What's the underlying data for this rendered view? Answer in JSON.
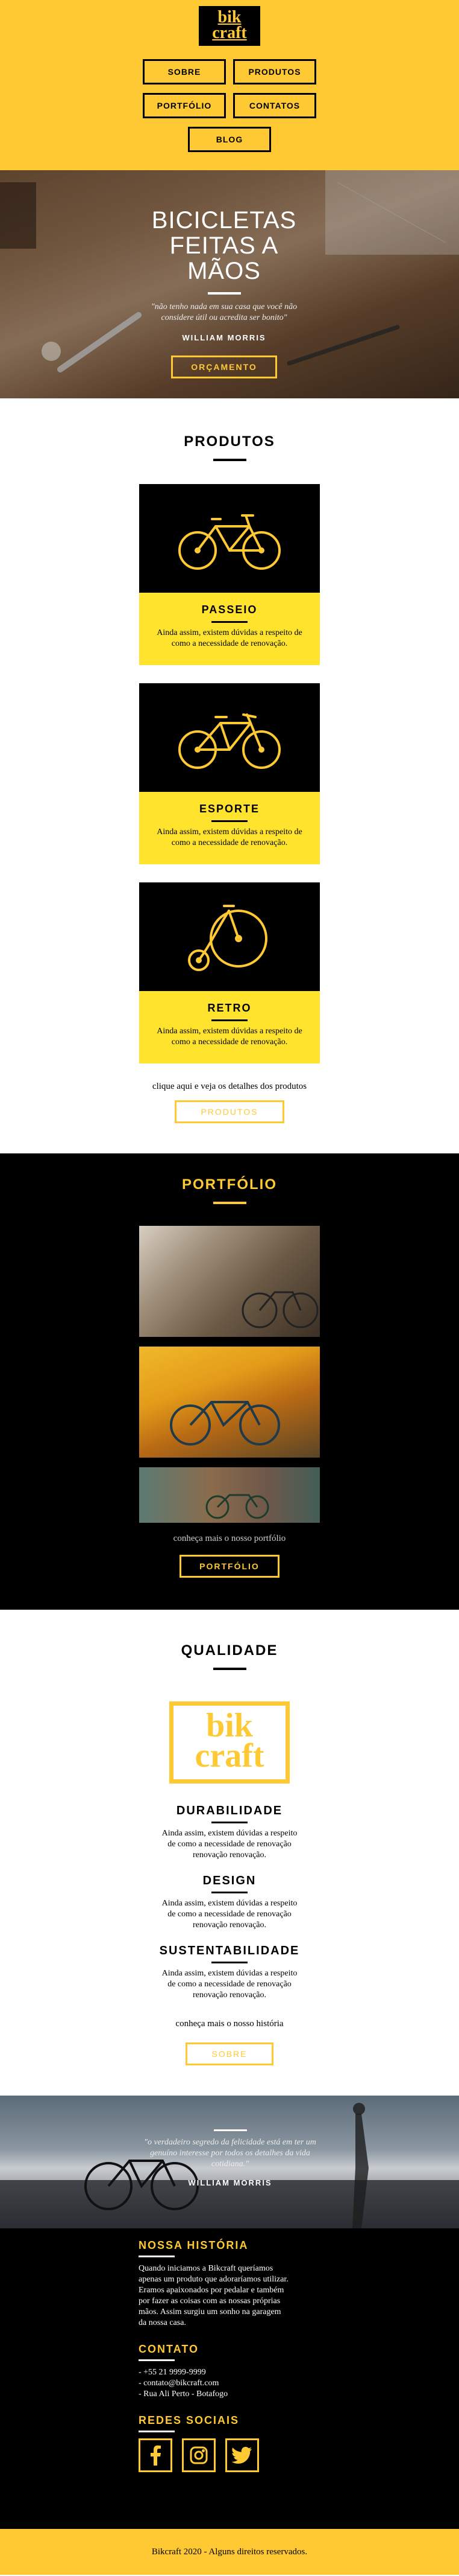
{
  "header": {
    "logo_line1": "bik",
    "logo_line2": "craft",
    "nav": [
      "SOBRE",
      "PRODUTOS",
      "PORTFÓLIO",
      "CONTATOS",
      "BLOG"
    ]
  },
  "hero": {
    "title": "BICICLETAS FEITAS A MÃOS",
    "quote": "\"não tenho nada em sua casa que você não considere útil ou acredita ser bonito\"",
    "author": "WILLIAM MORRIS",
    "button": "ORÇAMENTO"
  },
  "produtos": {
    "title": "PRODUTOS",
    "items": [
      {
        "name": "PASSEIO",
        "text": "Ainda assim, existem dúvidas a respeito de como a necessidade de renovação."
      },
      {
        "name": "ESPORTE",
        "text": "Ainda assim, existem dúvidas a respeito de como a necessidade de renovação."
      },
      {
        "name": "RETRO",
        "text": "Ainda assim, existem dúvidas a respeito de como a necessidade de renovação."
      }
    ],
    "more_text": "clique aqui e veja os detalhes dos produtos",
    "button": "PRODUTOS"
  },
  "portfolio": {
    "title": "PORTFÓLIO",
    "more_text": "conheça mais o nosso portfólio",
    "button": "PORTFÓLIO"
  },
  "qualidade": {
    "title": "QUALIDADE",
    "logo_line1": "bik",
    "logo_line2": "craft",
    "items": [
      {
        "name": "DURABILIDADE",
        "text": "Ainda assim, existem dúvidas a respeito de como a necessidade de renovação renovação renovação."
      },
      {
        "name": "DESIGN",
        "text": "Ainda assim, existem dúvidas a respeito de como a necessidade de renovação renovação renovação."
      },
      {
        "name": "SUSTENTABILIDADE",
        "text": "Ainda assim, existem dúvidas a respeito de como a necessidade de renovação renovação renovação."
      }
    ],
    "more_text": "conheça mais o nosso história",
    "button": "SOBRE"
  },
  "banner": {
    "quote": "\"o verdadeiro segredo da felicidade está em ter um genuíno interesse por todos os detalhes da vida cotidiana.\"",
    "author": "WILLIAM MORRIS"
  },
  "footer": {
    "historia_title": "NOSSA HISTÓRIA",
    "historia_text": "Quando iniciamos a Bikcraft queríamos apenas um produto que adoraríamos utilizar. Eramos apaixonados por pedalar e também por fazer as coisas com as nossas próprias mãos. Assim surgiu um sonho na garagem da nossa casa.",
    "contato_title": "CONTATO",
    "contatos": [
      "- +55 21 9999-9999",
      "- contato@bikcraft.com",
      "- Rua Ali Perto - Botafogo"
    ],
    "redes_title": "REDES SOCIAIS",
    "social_icons": [
      "facebook-icon",
      "instagram-icon",
      "twitter-icon"
    ]
  },
  "copyright": "Bikcraft 2020 - Alguns direitos reservados.",
  "colors": {
    "accent": "#ffc933",
    "card": "#ffe32d",
    "dark": "#000000"
  }
}
